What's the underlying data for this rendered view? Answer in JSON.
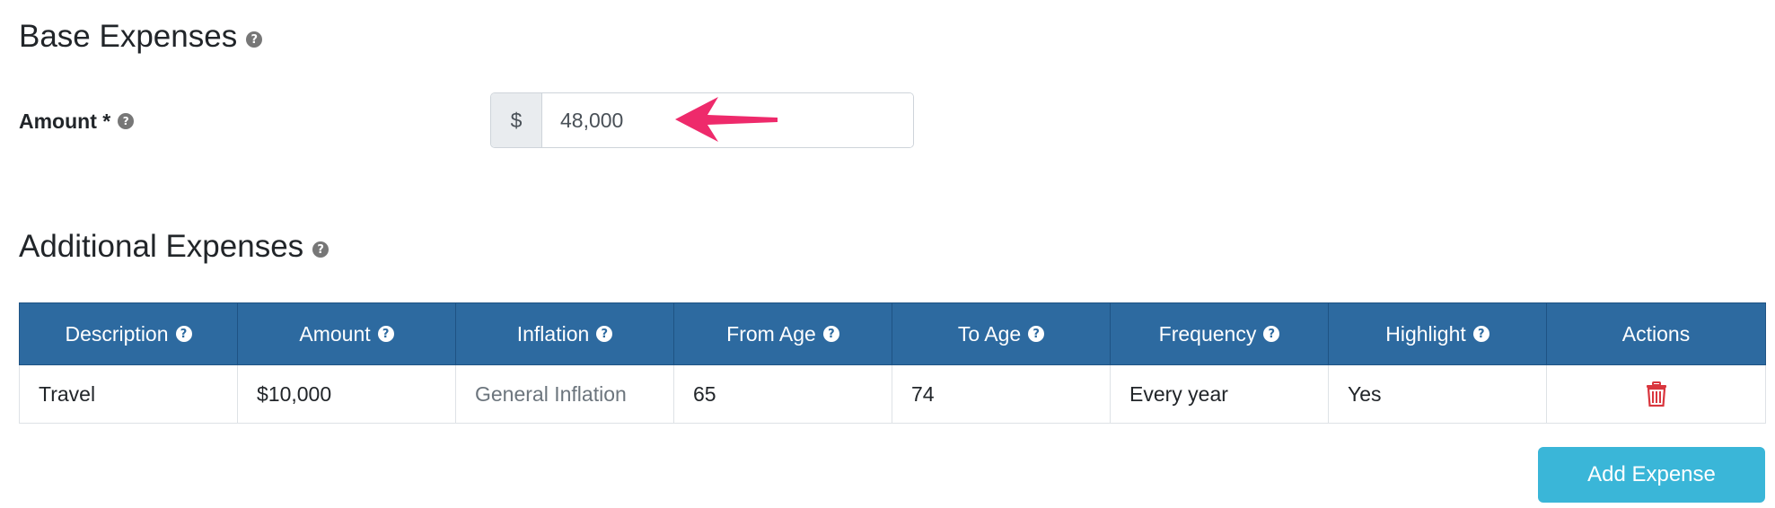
{
  "base_expenses": {
    "title": "Base Expenses",
    "help_icon": "question-circle-icon",
    "amount_label": "Amount *",
    "currency_prefix": "$",
    "amount_value": "48,000",
    "annotation": {
      "icon": "pink-arrow-icon",
      "color": "#ee2a6b"
    }
  },
  "additional_expenses": {
    "title": "Additional Expenses",
    "help_icon": "question-circle-icon",
    "table": {
      "header_color": "#2d6aa0",
      "columns": [
        "Description",
        "Amount",
        "Inflation",
        "From Age",
        "To Age",
        "Frequency",
        "Highlight",
        "Actions"
      ],
      "rows": [
        {
          "description": "Travel",
          "amount": "$10,000",
          "inflation": "General Inflation",
          "from_age": "65",
          "to_age": "74",
          "frequency": "Every year",
          "highlight": "Yes",
          "action_icon": "trash-icon",
          "action_color": "#d9363e"
        }
      ]
    },
    "add_button": {
      "label": "Add Expense",
      "color": "#3ab6d8"
    }
  }
}
